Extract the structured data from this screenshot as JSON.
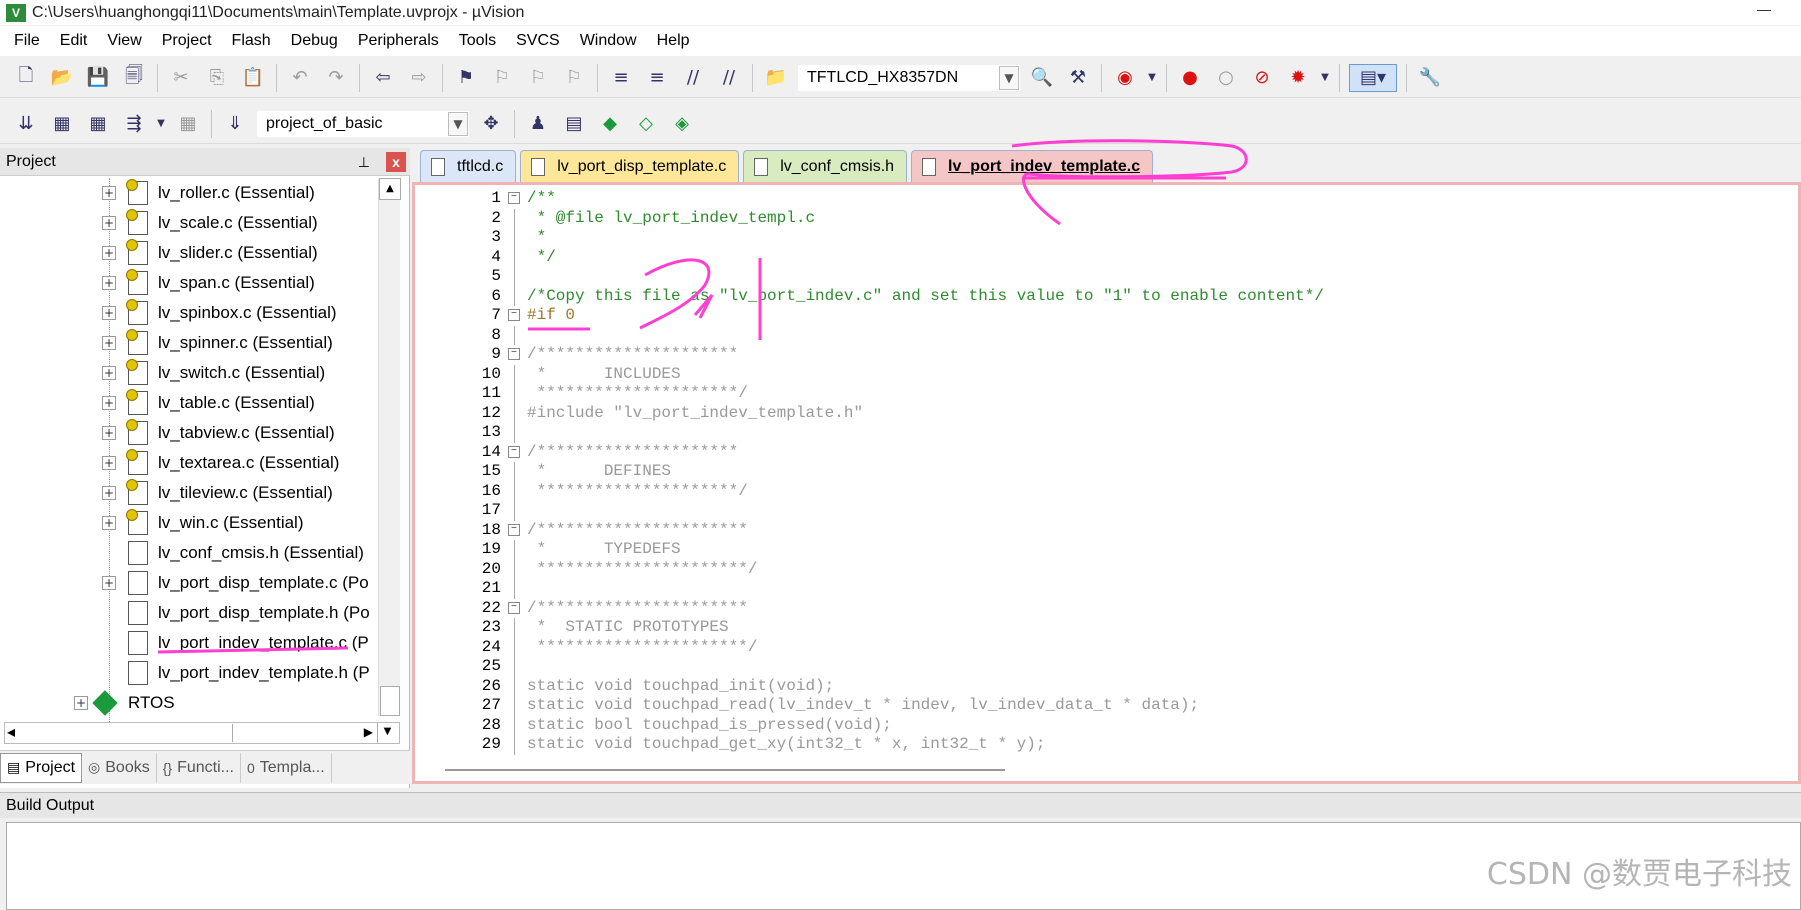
{
  "window": {
    "title": "C:\\Users\\huanghongqi11\\Documents\\main\\Template.uvprojx - µVision",
    "app_icon_label": "V"
  },
  "menubar": [
    "File",
    "Edit",
    "View",
    "Project",
    "Flash",
    "Debug",
    "Peripherals",
    "Tools",
    "SVCS",
    "Window",
    "Help"
  ],
  "toolbar1": {
    "target_combo": "TFTLCD_HX8357DN"
  },
  "toolbar2": {
    "project_combo": "project_of_basic"
  },
  "project_panel": {
    "title": "Project",
    "pin_glyph": "⊥",
    "close_glyph": "x",
    "items": [
      {
        "label": "lv_roller.c (Essential)",
        "icon": "key-file-icon",
        "expandable": true
      },
      {
        "label": "lv_scale.c (Essential)",
        "icon": "key-file-icon",
        "expandable": true
      },
      {
        "label": "lv_slider.c (Essential)",
        "icon": "key-file-icon",
        "expandable": true
      },
      {
        "label": "lv_span.c (Essential)",
        "icon": "key-file-icon",
        "expandable": true
      },
      {
        "label": "lv_spinbox.c (Essential)",
        "icon": "key-file-icon",
        "expandable": true
      },
      {
        "label": "lv_spinner.c (Essential)",
        "icon": "key-file-icon",
        "expandable": true
      },
      {
        "label": "lv_switch.c (Essential)",
        "icon": "key-file-icon",
        "expandable": true
      },
      {
        "label": "lv_table.c (Essential)",
        "icon": "key-file-icon",
        "expandable": true
      },
      {
        "label": "lv_tabview.c (Essential)",
        "icon": "key-file-icon",
        "expandable": true
      },
      {
        "label": "lv_textarea.c (Essential)",
        "icon": "key-file-icon",
        "expandable": true
      },
      {
        "label": "lv_tileview.c (Essential)",
        "icon": "key-file-icon",
        "expandable": true
      },
      {
        "label": "lv_win.c (Essential)",
        "icon": "key-file-icon",
        "expandable": true
      },
      {
        "label": "lv_conf_cmsis.h (Essential)",
        "icon": "file-icon",
        "expandable": false
      },
      {
        "label": "lv_port_disp_template.c (Po",
        "icon": "file-icon",
        "expandable": true
      },
      {
        "label": "lv_port_disp_template.h (Po",
        "icon": "file-icon",
        "expandable": false
      },
      {
        "label": "lv_port_indev_template.c (P",
        "icon": "file-icon",
        "expandable": false
      },
      {
        "label": "lv_port_indev_template.h (P",
        "icon": "file-icon",
        "expandable": false
      },
      {
        "label": "RTOS",
        "icon": "rtos-icon",
        "expandable": true
      }
    ],
    "bottom_tabs": [
      {
        "label": "Project",
        "icon": "project-tab-icon"
      },
      {
        "label": "Books",
        "icon": "books-icon"
      },
      {
        "label": "Functi...",
        "icon": "functions-icon",
        "glyph": "{}"
      },
      {
        "label": "Templa...",
        "icon": "templates-icon",
        "glyph": "0"
      }
    ]
  },
  "editor": {
    "tabs": [
      "tftlcd.c",
      "lv_port_disp_template.c",
      "lv_conf_cmsis.h",
      "lv_port_indev_template.c"
    ],
    "active_tab": "lv_port_indev_template.c",
    "lines": [
      {
        "n": "1",
        "text": "/**",
        "cls": "cmt",
        "fold": "minus"
      },
      {
        "n": "2",
        "text": " * @file lv_port_indev_templ.c",
        "cls": "cmt"
      },
      {
        "n": "3",
        "text": " *",
        "cls": "cmt"
      },
      {
        "n": "4",
        "text": " */",
        "cls": "cmt"
      },
      {
        "n": "5",
        "text": "",
        "cls": "plain"
      },
      {
        "n": "6",
        "text": "/*Copy this file as \"lv_port_indev.c\" and set this value to \"1\" to enable content*/",
        "cls": "cmt"
      },
      {
        "n": "7",
        "text": "#if 0",
        "cls": "pre",
        "fold": "minus"
      },
      {
        "n": "8",
        "text": "",
        "cls": "plain"
      },
      {
        "n": "9",
        "text": "/*********************",
        "cls": "cmtgray",
        "fold": "minus"
      },
      {
        "n": "10",
        "text": " *      INCLUDES",
        "cls": "cmtgray"
      },
      {
        "n": "11",
        "text": " *********************/",
        "cls": "cmtgray"
      },
      {
        "n": "12",
        "text": "#include \"lv_port_indev_template.h\"",
        "cls": "cmtgray"
      },
      {
        "n": "13",
        "text": "",
        "cls": "plain"
      },
      {
        "n": "14",
        "text": "/*********************",
        "cls": "cmtgray",
        "fold": "minus"
      },
      {
        "n": "15",
        "text": " *      DEFINES",
        "cls": "cmtgray"
      },
      {
        "n": "16",
        "text": " *********************/",
        "cls": "cmtgray"
      },
      {
        "n": "17",
        "text": "",
        "cls": "plain"
      },
      {
        "n": "18",
        "text": "/**********************",
        "cls": "cmtgray",
        "fold": "minus"
      },
      {
        "n": "19",
        "text": " *      TYPEDEFS",
        "cls": "cmtgray"
      },
      {
        "n": "20",
        "text": " **********************/",
        "cls": "cmtgray"
      },
      {
        "n": "21",
        "text": "",
        "cls": "plain"
      },
      {
        "n": "22",
        "text": "/**********************",
        "cls": "cmtgray",
        "fold": "minus"
      },
      {
        "n": "23",
        "text": " *  STATIC PROTOTYPES",
        "cls": "cmtgray"
      },
      {
        "n": "24",
        "text": " **********************/",
        "cls": "cmtgray"
      },
      {
        "n": "25",
        "text": "",
        "cls": "plain"
      },
      {
        "n": "26",
        "text": "static void touchpad_init(void);",
        "cls": "cmtgray"
      },
      {
        "n": "27",
        "text": "static void touchpad_read(lv_indev_t * indev, lv_indev_data_t * data);",
        "cls": "cmtgray"
      },
      {
        "n": "28",
        "text": "static bool touchpad_is_pressed(void);",
        "cls": "cmtgray"
      },
      {
        "n": "29",
        "text": "static void touchpad_get_xy(int32_t * x, int32_t * y);",
        "cls": "cmtgray"
      }
    ]
  },
  "build_output": {
    "title": "Build Output"
  },
  "watermark": "CSDN @数贾电子科技",
  "colors": {
    "annotation": "#ff3fd2",
    "comment": "#2e8b2e",
    "keyword": "#4a5fd4",
    "string": "#b040b0",
    "active_tab": "#f4c6c6"
  }
}
